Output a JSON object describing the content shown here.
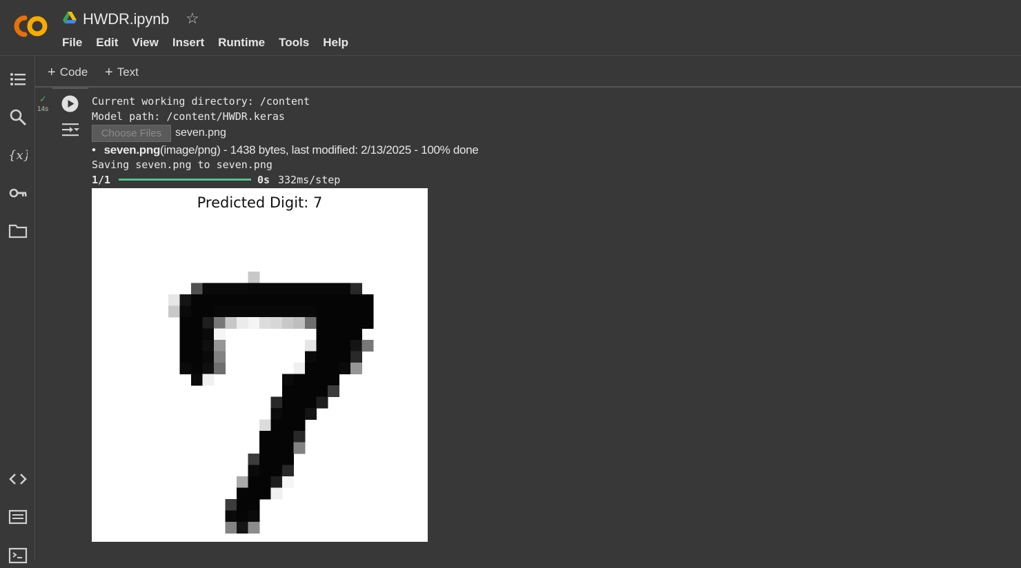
{
  "app": {
    "title": "HWDR.ipynb",
    "star_icon": "☆",
    "logo_text": "CO"
  },
  "menu": [
    "File",
    "Edit",
    "View",
    "Insert",
    "Runtime",
    "Tools",
    "Help"
  ],
  "toolbar": {
    "add_code_label": "Code",
    "add_text_label": "Text",
    "plus": "+"
  },
  "cell": {
    "status_icon": "✓",
    "exec_time": "14s",
    "output": {
      "cwd_line": "Current working directory: /content",
      "model_line": "Model path: /content/HWDR.keras",
      "choose_files_label": "Choose Files",
      "chosen_file": "seven.png",
      "upload_bullet": "•",
      "upload_filename": "seven.png",
      "upload_details": "(image/png) - 1438 bytes, last modified: 2/13/2025 - 100% done",
      "saving_line": "Saving seven.png to seven.png",
      "progress_count": "1/1",
      "progress_fraction": 1.0,
      "progress_time": "0s",
      "progress_step": "332ms/step"
    },
    "plot": {
      "title": "Predicted Digit: 7"
    }
  },
  "colors": {
    "background": "#383838",
    "progress": "#4fc48d",
    "logo_orange": "#f9ab00",
    "logo_dark_orange": "#e8710a"
  }
}
